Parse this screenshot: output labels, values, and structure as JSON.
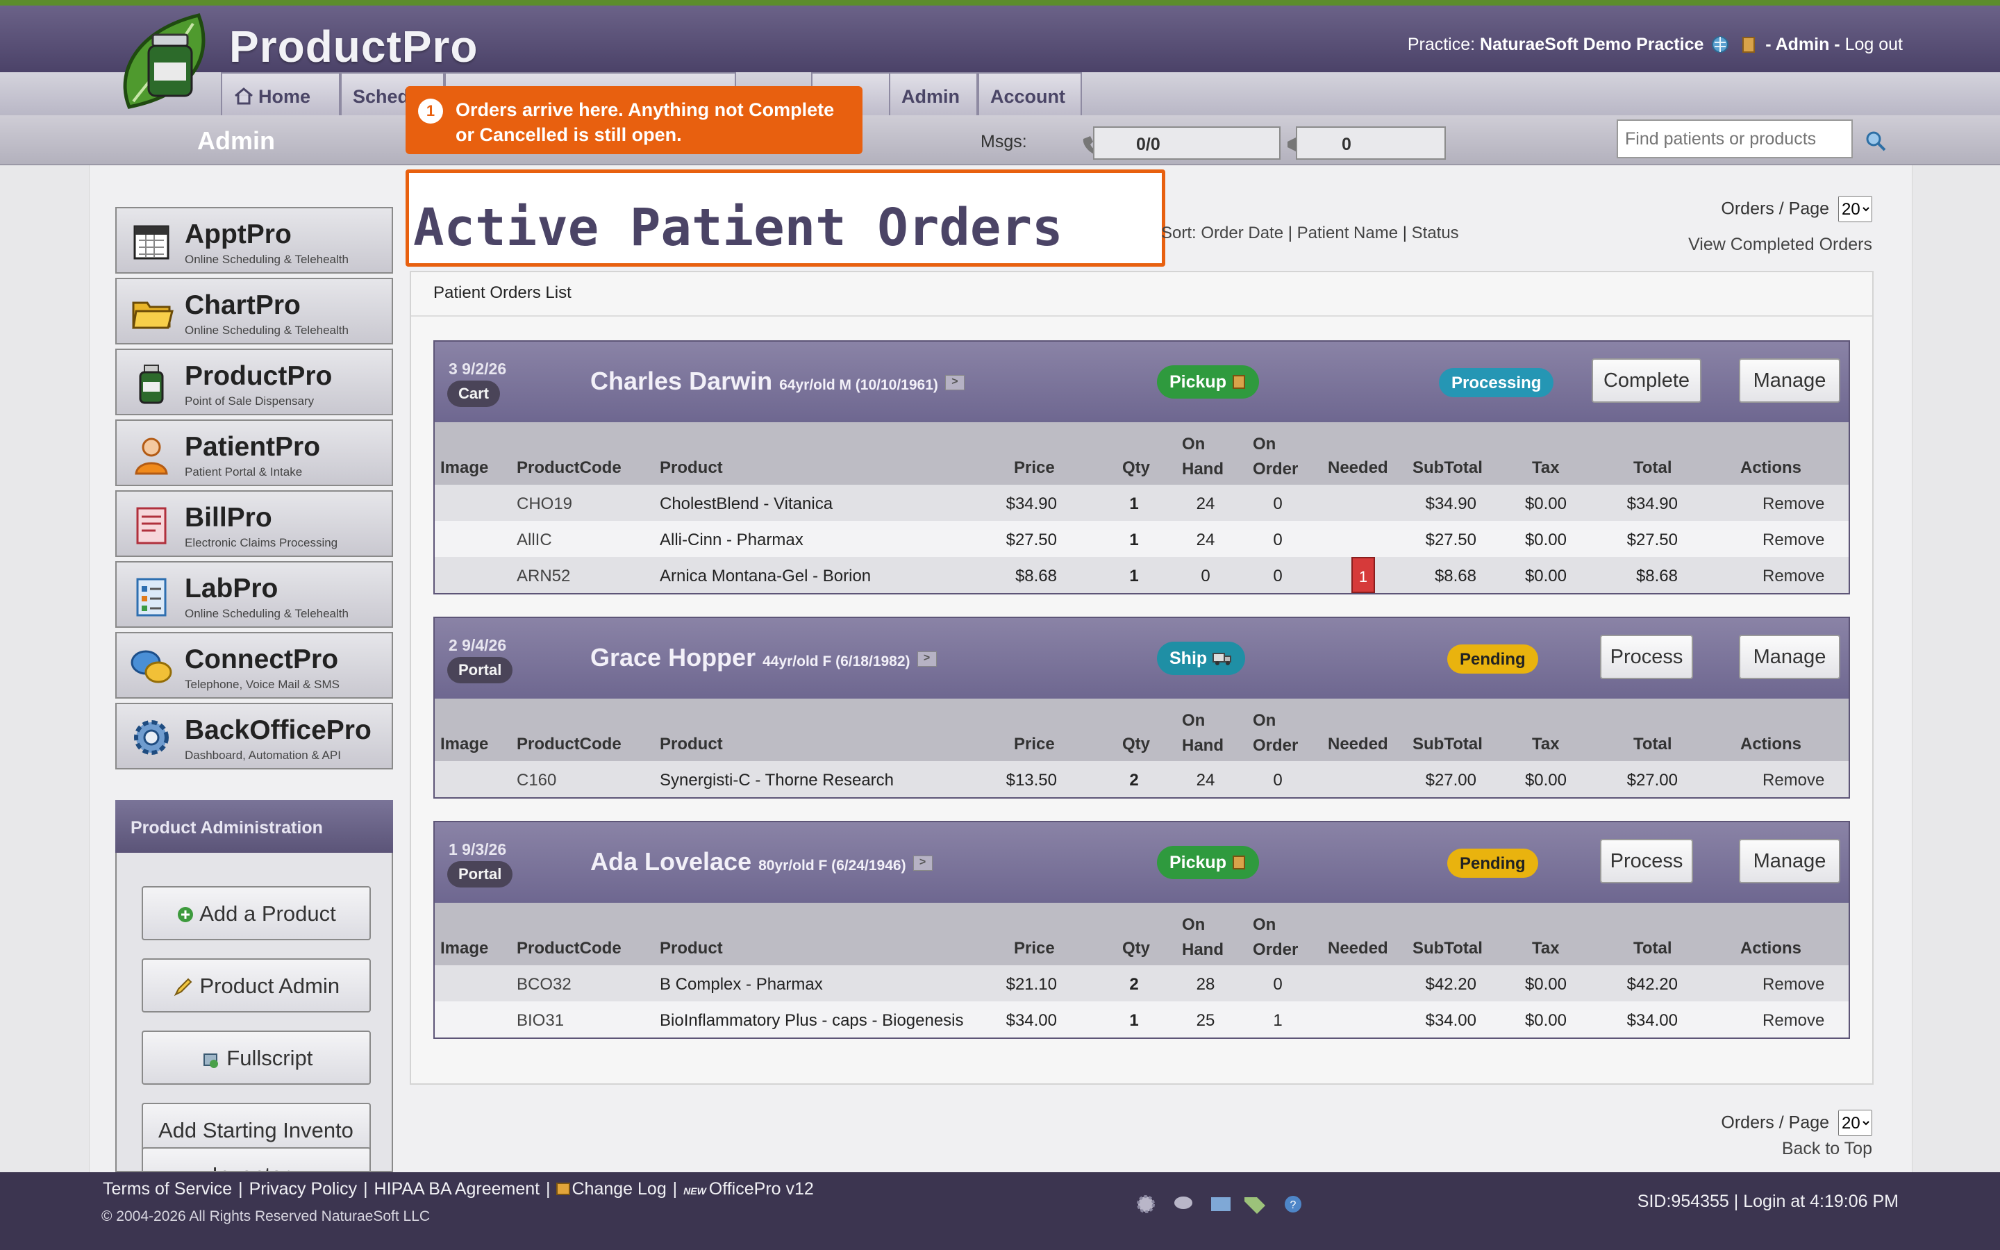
{
  "app": {
    "brand": "ProductPro",
    "practice_label": "Practice:",
    "practice_name": "NaturaeSoft Demo Practice",
    "user": "- Admin -",
    "logout": "Log out"
  },
  "nav": {
    "tabs": [
      "Home",
      "Sched",
      "Admin",
      "Account"
    ]
  },
  "subbar": {
    "section_title": "Admin",
    "msgs_label": "Msgs:",
    "msgs_count": "0/0",
    "fax_count": "0",
    "search_placeholder": "Find patients or products"
  },
  "tooltip": {
    "step": "1",
    "text": "Orders arrive here. Anything not Complete or Cancelled is still open."
  },
  "sidebar": {
    "apps": [
      {
        "name": "ApptPro",
        "sub": "Online Scheduling & Telehealth",
        "icon": "calendar-icon"
      },
      {
        "name": "ChartPro",
        "sub": "Online Scheduling & Telehealth",
        "icon": "folder-icon"
      },
      {
        "name": "ProductPro",
        "sub": "Point of Sale Dispensary",
        "icon": "bottle-icon"
      },
      {
        "name": "PatientPro",
        "sub": "Patient Portal & Intake",
        "icon": "patient-icon"
      },
      {
        "name": "BillPro",
        "sub": "Electronic Claims Processing",
        "icon": "bill-icon"
      },
      {
        "name": "LabPro",
        "sub": "Online Scheduling & Telehealth",
        "icon": "clipboard-icon"
      },
      {
        "name": "ConnectPro",
        "sub": "Telephone, Voice Mail & SMS",
        "icon": "chat-icon"
      },
      {
        "name": "BackOfficePro",
        "sub": "Dashboard, Automation & API",
        "icon": "gear-icon"
      }
    ],
    "product_admin_title": "Product Administration",
    "buttons": [
      "Add a Product",
      "Product Admin",
      "Fullscript",
      "Add Starting Invento",
      "Inventory"
    ]
  },
  "main": {
    "title": "Active Patient Orders",
    "sort_label": "Sort:",
    "sort_options": [
      "Order Date",
      "Patient Name",
      "Status"
    ],
    "orders_per_page_label": "Orders / Page",
    "orders_per_page": "20",
    "view_completed": "View Completed Orders",
    "list_label": "Patient Orders List",
    "back_to_top": "Back to Top",
    "columns": [
      "Image",
      "ProductCode",
      "Product",
      "Price",
      "Qty",
      "On Hand",
      "On Order",
      "Needed",
      "SubTotal",
      "Tax",
      "Total",
      "Actions"
    ]
  },
  "orders": [
    {
      "number": "3 9/2/26",
      "source": "Cart",
      "patient": "Charles Darwin",
      "details": "64yr/old M (10/10/1961)",
      "method": "Pickup",
      "status": "Processing",
      "primary_action": "Complete",
      "manage": "Manage",
      "items": [
        {
          "code": "CHO19",
          "product": "CholestBlend - Vitanica",
          "price": "$34.90",
          "qty": "1",
          "on_hand": "24",
          "on_order": "0",
          "needed": "",
          "subtotal": "$34.90",
          "tax": "$0.00",
          "total": "$34.90",
          "action": "Remove"
        },
        {
          "code": "AllIC",
          "product": "Alli-Cinn - Pharmax",
          "price": "$27.50",
          "qty": "1",
          "on_hand": "24",
          "on_order": "0",
          "needed": "",
          "subtotal": "$27.50",
          "tax": "$0.00",
          "total": "$27.50",
          "action": "Remove"
        },
        {
          "code": "ARN52",
          "product": "Arnica Montana-Gel - Borion",
          "price": "$8.68",
          "qty": "1",
          "on_hand": "0",
          "on_order": "0",
          "needed": "1",
          "subtotal": "$8.68",
          "tax": "$0.00",
          "total": "$8.68",
          "action": "Remove"
        }
      ]
    },
    {
      "number": "2 9/4/26",
      "source": "Portal",
      "patient": "Grace Hopper",
      "details": "44yr/old F (6/18/1982)",
      "method": "Ship",
      "status": "Pending",
      "primary_action": "Process",
      "manage": "Manage",
      "items": [
        {
          "code": "C160",
          "product": "Synergisti-C - Thorne Research",
          "price": "$13.50",
          "qty": "2",
          "on_hand": "24",
          "on_order": "0",
          "needed": "",
          "subtotal": "$27.00",
          "tax": "$0.00",
          "total": "$27.00",
          "action": "Remove"
        }
      ]
    },
    {
      "number": "1 9/3/26",
      "source": "Portal",
      "patient": "Ada Lovelace",
      "details": "80yr/old F (6/24/1946)",
      "method": "Pickup",
      "status": "Pending",
      "primary_action": "Process",
      "manage": "Manage",
      "items": [
        {
          "code": "BCO32",
          "product": "B Complex - Pharmax",
          "price": "$21.10",
          "qty": "2",
          "on_hand": "28",
          "on_order": "0",
          "needed": "",
          "subtotal": "$42.20",
          "tax": "$0.00",
          "total": "$42.20",
          "action": "Remove"
        },
        {
          "code": "BIO31",
          "product": "BioInflammatory Plus - caps - Biogenesis",
          "price": "$34.00",
          "qty": "1",
          "on_hand": "25",
          "on_order": "1",
          "needed": "",
          "subtotal": "$34.00",
          "tax": "$0.00",
          "total": "$34.00",
          "action": "Remove"
        }
      ]
    }
  ],
  "footer": {
    "links": [
      "Terms of Service",
      "Privacy Policy",
      "HIPAA BA Agreement",
      "Change Log",
      "OfficePro v12"
    ],
    "new_badge": "NEW",
    "copyright": "© 2004-2026 All Rights Reserved NaturaeSoft LLC",
    "session": "SID:954355 | Login at 4:19:06 PM"
  },
  "colors": {
    "accent_orange": "#e8600f",
    "pickup_green": "#2f9a3e",
    "ship_teal": "#1f8fa5",
    "processing_teal": "#2596b4",
    "pending_yellow": "#e9b30e",
    "header_purple": "#5b5478"
  }
}
